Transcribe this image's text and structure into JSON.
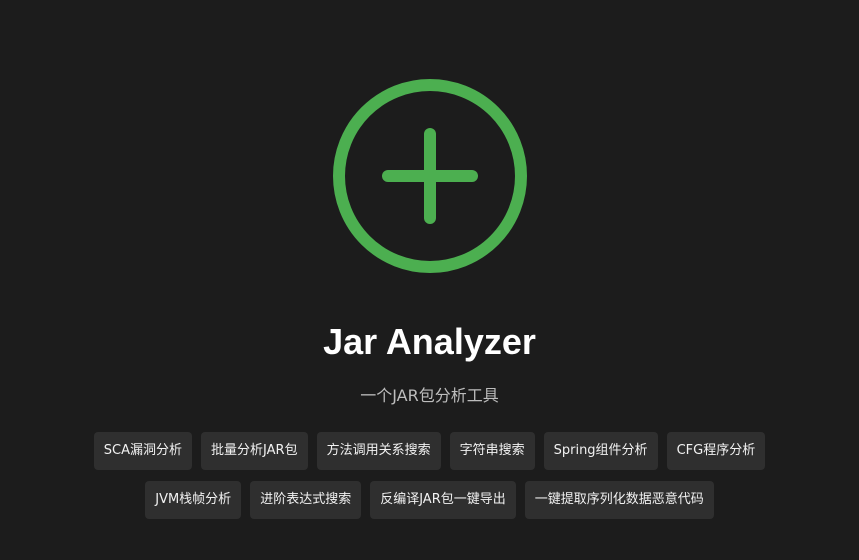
{
  "app": {
    "title": "Jar Analyzer",
    "subtitle": "一个JAR包分析工具",
    "accent_color": "#4caf50",
    "logo_icon": "plus-circle-icon"
  },
  "tags": {
    "row1": [
      "SCA漏洞分析",
      "批量分析JAR包",
      "方法调用关系搜索",
      "字符串搜索",
      "Spring组件分析",
      "CFG程序分析"
    ],
    "row2": [
      "JVM栈帧分析",
      "进阶表达式搜索",
      "反编译JAR包一键导出",
      "一键提取序列化数据恶意代码"
    ]
  }
}
